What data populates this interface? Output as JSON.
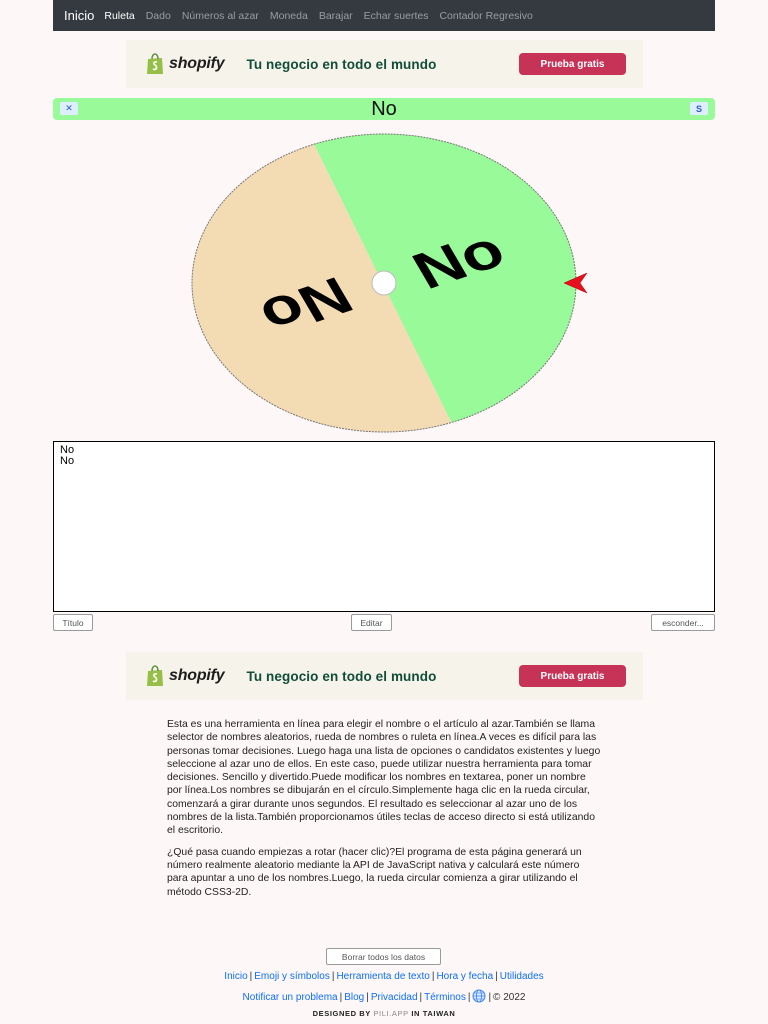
{
  "nav": {
    "brand": "Inicio",
    "links": [
      "Ruleta",
      "Dado",
      "Números al azar",
      "Moneda",
      "Barajar",
      "Echar suertes",
      "Contador Regresivo"
    ]
  },
  "ad": {
    "brand": "shopify",
    "text": "Tu negocio en todo el mundo",
    "button": "Prueba gratis"
  },
  "result": {
    "left_button": "✕",
    "right_button": "S",
    "text": "No"
  },
  "wheel": {
    "segments": [
      {
        "label": "No",
        "color": "#98fa98"
      },
      {
        "label": "No",
        "color": "#f3dbb3"
      }
    ],
    "pointer_color": "#e8101e"
  },
  "names": [
    "No",
    "No"
  ],
  "buttons": {
    "title": "Título",
    "edit": "Editar",
    "hide": "esconder..."
  },
  "description": [
    "Esta es una herramienta en línea para elegir el nombre o el artículo al azar.También se llama selector de nombres aleatorios, rueda de nombres o ruleta en línea.A veces es difícil para las personas tomar decisiones. Luego haga una lista de opciones o candidatos existentes y luego seleccione al azar uno de ellos. En este caso, puede utilizar nuestra herramienta para tomar decisiones. Sencillo y divertido.Puede modificar los nombres en textarea, poner un nombre por línea.Los nombres se dibujarán en el círculo.Simplemente haga clic en la rueda circular, comenzará a girar durante unos segundos. El resultado es seleccionar al azar uno de los nombres de la lista.También proporcionamos útiles teclas de acceso directo si está utilizando el escritorio.",
    "¿Qué pasa cuando empiezas a rotar (hacer clic)?El programa de esta página generará un número realmente aleatorio mediante la API de JavaScript nativa y calculará este número para apuntar a uno de los nombres.Luego, la rueda circular comienza a girar utilizando el método CSS3-2D."
  ],
  "footer": {
    "clear_button": "Borrar todos los datos",
    "row1": [
      "Inicio",
      "Emoji y símbolos",
      "Herramienta de texto",
      "Hora y fecha",
      "Utilidades"
    ],
    "row2": [
      "Notificar un problema",
      "Blog",
      "Privacidad",
      "Términos"
    ],
    "copyright": "© 2022",
    "credit_prefix": "DESIGNED BY",
    "credit_site": "PILI.APP",
    "credit_suffix": "IN TAIWAN"
  }
}
